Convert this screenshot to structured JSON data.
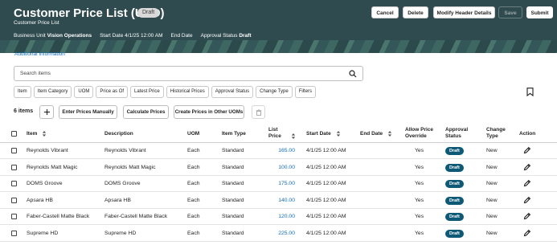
{
  "header": {
    "title": "Customer Price List (USD)",
    "status_pill": "Draft",
    "subtitle": "Customer Price List",
    "meta": [
      {
        "label": "Business Unit",
        "value": "Vision Operations"
      },
      {
        "label": "Start Date",
        "value": "4/1/25 12:00 AM"
      },
      {
        "label": "End Date",
        "value": ""
      },
      {
        "label": "Approval Status",
        "value": "Draft"
      }
    ],
    "buttons": {
      "cancel": "Cancel",
      "delete": "Delete",
      "modify": "Modify Header Details",
      "save": "Save",
      "submit": "Submit"
    }
  },
  "additional_info_link": "Additional Information",
  "search": {
    "placeholder": "Search items"
  },
  "filter_chips": [
    "Item",
    "Item Category",
    "UOM",
    "Price as Of",
    "Latest Price",
    "Historical Prices",
    "Approval Status",
    "Change Type",
    "Filters"
  ],
  "toolbar": {
    "count": "6 items",
    "enter_prices": "Enter Prices Manually",
    "calculate": "Calculate Prices",
    "create_other_uoms": "Create Prices in Other UOMs"
  },
  "columns": {
    "item": "Item",
    "description": "Description",
    "uom": "UOM",
    "item_type": "Item Type",
    "list_price_1": "List",
    "list_price_2": "Price",
    "start_date": "Start Date",
    "end_date": "End Date",
    "override_1": "Allow Price",
    "override_2": "Override",
    "approval_1": "Approval",
    "approval_2": "Status",
    "change_1": "Change",
    "change_2": "Type",
    "action": "Action"
  },
  "rows": [
    {
      "item": "Reynolds Vibrant",
      "description": "Reynolds Vibrant",
      "uom": "Each",
      "type": "Standard",
      "price": "165.00",
      "start": "4/1/25 12:00 AM",
      "end": "",
      "override": "Yes",
      "approval": "Draft",
      "change": "New"
    },
    {
      "item": "Reynolds Matt Magic",
      "description": "Reynolds Matt Magic",
      "uom": "Each",
      "type": "Standard",
      "price": "100.00",
      "start": "4/1/25 12:00 AM",
      "end": "",
      "override": "Yes",
      "approval": "Draft",
      "change": "New"
    },
    {
      "item": "DOMS Groove",
      "description": "DOMS Groove",
      "uom": "Each",
      "type": "Standard",
      "price": "175.00",
      "start": "4/1/25 12:00 AM",
      "end": "",
      "override": "Yes",
      "approval": "Draft",
      "change": "New"
    },
    {
      "item": "Apsara HB",
      "description": "Apsara HB",
      "uom": "Each",
      "type": "Standard",
      "price": "140.00",
      "start": "4/1/25 12:00 AM",
      "end": "",
      "override": "Yes",
      "approval": "Draft",
      "change": "New"
    },
    {
      "item": "Faber-Castell Matte Black",
      "description": "Faber-Castell Matte Black",
      "uom": "Each",
      "type": "Standard",
      "price": "120.00",
      "start": "4/1/25 12:00 AM",
      "end": "",
      "override": "Yes",
      "approval": "Draft",
      "change": "New"
    },
    {
      "item": "Supreme HD",
      "description": "Supreme HD",
      "uom": "Each",
      "type": "Standard",
      "price": "225.00",
      "start": "4/1/25 12:00 AM",
      "end": "",
      "override": "Yes",
      "approval": "Draft",
      "change": "New"
    }
  ],
  "colors": {
    "header_bg": "#2f4b4f",
    "badge": "#0e5a76",
    "link": "#0f6cbd"
  },
  "icons": [
    "search-icon",
    "bookmark-icon",
    "add-icon",
    "trash-icon",
    "sort-icon",
    "pencil-icon"
  ]
}
